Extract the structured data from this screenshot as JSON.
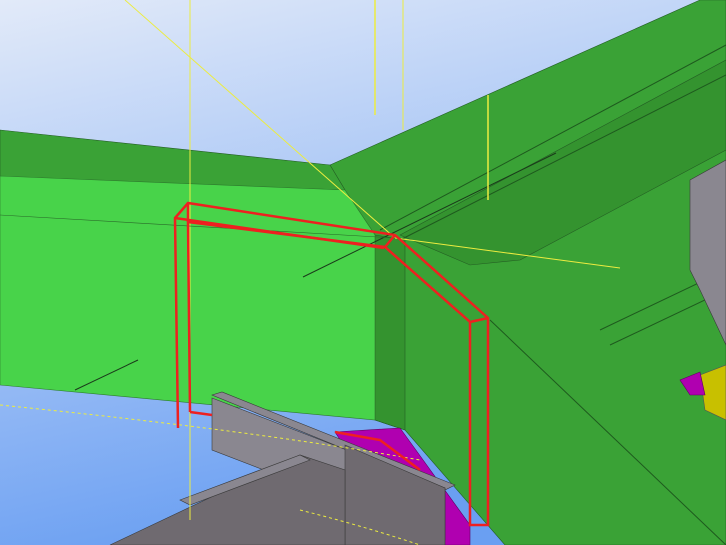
{
  "viewport": {
    "colors": {
      "sky_top": "#e2eaf9",
      "sky_bottom": "#6a9ff2",
      "beam_light": "#48d34a",
      "beam_dark": "#3aa236",
      "beam_shade": "#34932f",
      "plate_grey": "#8a8790",
      "plate_dark": "#6f6a70",
      "magenta": "#b000b0",
      "yellow_part": "#c8c000",
      "selection_red": "#ee2020",
      "grid_yellow": "#ecec40"
    }
  }
}
